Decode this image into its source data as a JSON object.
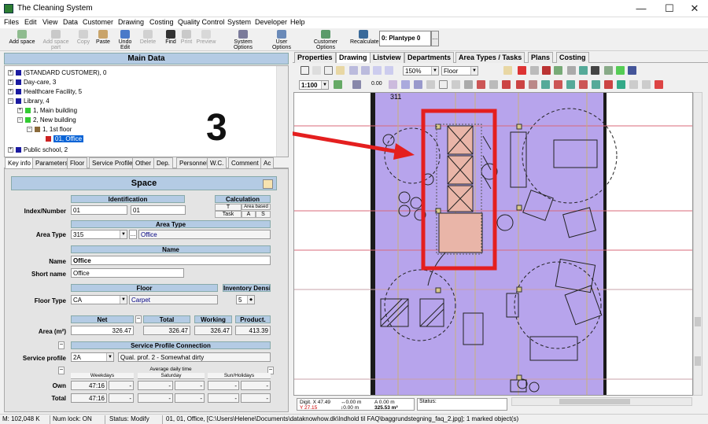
{
  "window": {
    "title": "The Cleaning System",
    "minimize": "—",
    "maximize": "☐",
    "close": "✕"
  },
  "menu": [
    "Files",
    "Edit",
    "View",
    "Data",
    "Customer",
    "Drawing",
    "Costing",
    "Quality Control",
    "System",
    "Developer",
    "Help"
  ],
  "toolbar": {
    "add_space": "Add space",
    "add_space_part": "Add space part",
    "copy": "Copy",
    "paste": "Paste",
    "undo_edit": "Undo Edit",
    "delete": "Delete",
    "find": "Find",
    "print": "Print",
    "preview": "Preview",
    "system_options": "System Options",
    "user_options": "User Options",
    "customer_options": "Customer Options",
    "recalculate": "Recalculate",
    "plantype": "0: Plantype 0",
    "plantype_more": "..."
  },
  "left": {
    "title": "Main Data",
    "tree": [
      {
        "label": "(STANDARD CUSTOMER), 0",
        "exp": "+",
        "color": "#1a1aa0"
      },
      {
        "label": "Day-care, 3",
        "exp": "+",
        "color": "#1a1aa0"
      },
      {
        "label": "Healthcare Facility, 5",
        "exp": "+",
        "color": "#1a1aa0"
      },
      {
        "label": "Library, 4",
        "exp": "−",
        "color": "#1a1aa0"
      },
      {
        "label": "1, Main building",
        "exp": "+",
        "color": "#33cc33"
      },
      {
        "label": "2, New building",
        "exp": "−",
        "color": "#33cc33"
      },
      {
        "label": "1, 1st floor",
        "exp": "−",
        "color": "#8a6a3a"
      },
      {
        "label": "01, Office",
        "exp": "",
        "color": "#cc2222"
      },
      {
        "label": "Public school, 2",
        "exp": "+",
        "color": "#1a1aa0"
      }
    ],
    "tabs": [
      "Key info",
      "Parameters",
      "Floor",
      "Service Profile",
      "Other",
      "Dep.",
      "Personnel",
      "W.C.",
      "Comment",
      "Ac"
    ],
    "form": {
      "title": "Space",
      "identification": "Identification",
      "calculation": "Calculation",
      "calc_t": "T",
      "calc_area_based": "Area based",
      "calc_task": "Task",
      "calc_a": "A",
      "calc_s": "S",
      "index_label": "Index/Number",
      "index_value": "01",
      "number_value": "01",
      "area_type_section": "Area Type",
      "area_type_label": "Area Type",
      "area_type_code": "315",
      "area_type_more": "...",
      "area_type_name": "Office",
      "name_section": "Name",
      "name_label": "Name",
      "name_value": "Office",
      "short_name_label": "Short name",
      "short_name_value": "Office",
      "floor_section": "Floor",
      "inventory_section": "Inventory Densit",
      "floor_type_label": "Floor Type",
      "floor_type_code": "CA",
      "floor_type_name": "Carpet",
      "inventory_value": "5",
      "net_label": "Net",
      "total_label": "Total",
      "working_label": "Working",
      "product_label": "Product.",
      "area_label": "Area (m²)",
      "net_value": "326.47",
      "total_value": "326.47",
      "working_value": "326.47",
      "product_value": "413.39",
      "spc_section": "Service Profile Connection",
      "service_profile_label": "Service profile",
      "sp_code": "2A",
      "sp_name": "Qual. prof. 2 - Somewhat dirty",
      "avg_time": "Average daily time",
      "weekdays": "Weekdays",
      "saturday": "Saturday",
      "sunday": "Sun/Holidays",
      "own_label": "Own",
      "total_row_label": "Total",
      "own_weekdays": "47:16",
      "total_weekdays": "47:16",
      "dash": "-"
    }
  },
  "right": {
    "tabs": [
      "Properties",
      "Drawing",
      "Listview",
      "Departments",
      "Area Types / Tasks",
      "Plans",
      "Costing"
    ],
    "zoom": "150%",
    "floor_select": "Floor",
    "scale": "1:100",
    "angle": "0.00",
    "annotation": "3",
    "drawing_label": "311",
    "coords": {
      "digit_x": "Digit. X 47.49",
      "digit_y": "Y 27.15",
      "dx": "↔0.00 m",
      "dy": "↕0.00 m",
      "angle": "A 0.00 m",
      "area": "325.53 m²"
    },
    "status_label": "Status:"
  },
  "statusbar": {
    "memory": "M: 102,048 K",
    "numlock": "Num lock: ON",
    "status": "Status: Modify",
    "info": "01, 01, Office, [C:\\Users\\Helene\\Documents\\dataknowhow.dk\\Indhold til FAQ\\baggrundstegning_faq_2.jpg]; 1 marked object(s)"
  }
}
